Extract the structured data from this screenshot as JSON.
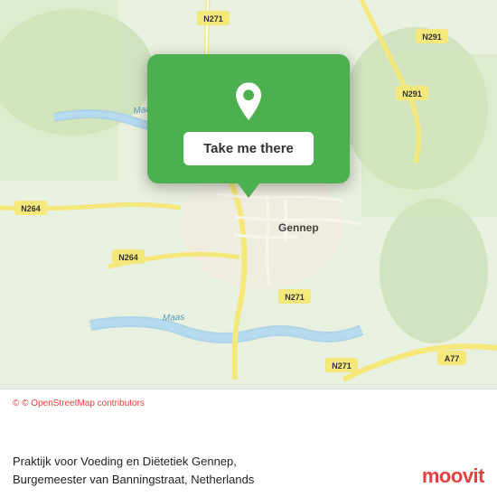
{
  "map": {
    "popup": {
      "button_label": "Take me there"
    },
    "location": {
      "city": "Gennep",
      "country": "Netherlands"
    },
    "roads": [
      {
        "id": "N271_top",
        "label": "N271"
      },
      {
        "id": "N291_right",
        "label": "N291"
      },
      {
        "id": "N264_left",
        "label": "N264"
      },
      {
        "id": "N264_mid",
        "label": "N264"
      },
      {
        "id": "N271_mid",
        "label": "N271"
      },
      {
        "id": "N271_bot",
        "label": "N271"
      },
      {
        "id": "A77_bot",
        "label": "A77"
      },
      {
        "id": "Maas_top",
        "label": "Maas"
      },
      {
        "id": "Maas_bot",
        "label": "Maas"
      }
    ]
  },
  "info_bar": {
    "copyright": "© OpenStreetMap contributors",
    "address_line1": "Praktijk voor Voeding en Diëtetiek Gennep,",
    "address_line2": "Burgemeester van Banningstraat, Netherlands"
  },
  "moovit": {
    "logo_text": "moovit"
  },
  "icons": {
    "pin": "📍",
    "copyright_c": "©"
  }
}
